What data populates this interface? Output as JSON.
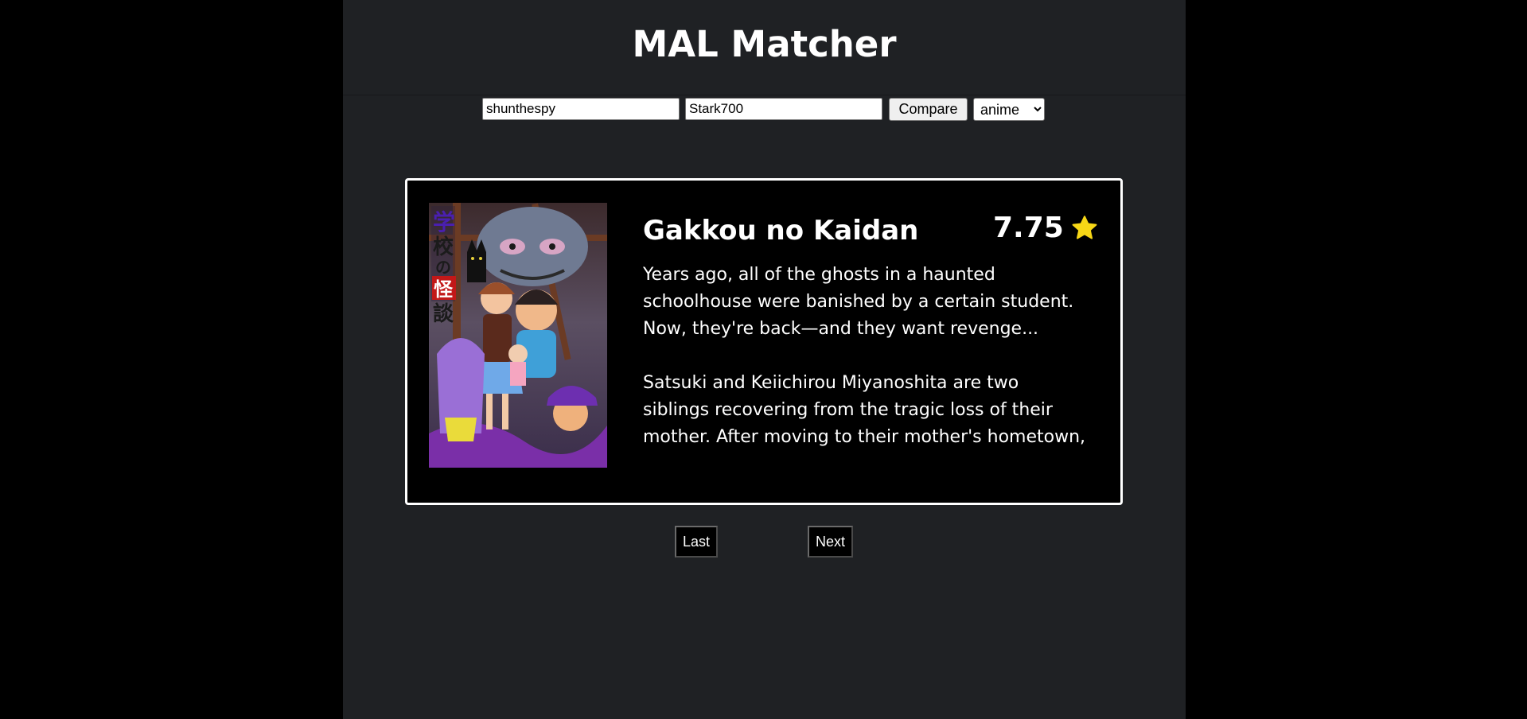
{
  "header": {
    "title": "MAL Matcher"
  },
  "controls": {
    "user1_value": "shunthespy",
    "user2_value": "Stark700",
    "compare_label": "Compare",
    "type_options": [
      "anime"
    ],
    "type_selected": "anime"
  },
  "entry": {
    "title": "Gakkou no Kaidan",
    "score": "7.75",
    "score_icon": "star-icon",
    "synopsis_p1": "Years ago, all of the ghosts in a haunted schoolhouse were banished by a certain student. Now, they're back—and they want revenge...",
    "synopsis_p2": "Satsuki and Keiichirou Miyanoshita are two siblings recovering from the tragic loss of their mother. After moving to their mother's hometown, the siblings enroll at the local school and",
    "cover_title_text": "学校の怪談"
  },
  "nav": {
    "last_label": "Last",
    "next_label": "Next"
  },
  "colors": {
    "page_background": "#1f2124",
    "outer_background": "#000000",
    "card_background": "#000000",
    "card_border": "#ffffff",
    "star": "#f7d716",
    "text": "#ffffff"
  }
}
